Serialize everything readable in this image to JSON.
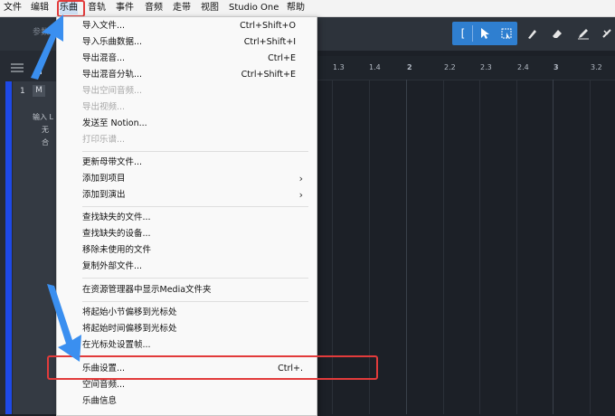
{
  "menubar": {
    "items": [
      "文件",
      "编辑",
      "乐曲",
      "音轨",
      "事件",
      "音频",
      "走带",
      "视图",
      "Studio One",
      "帮助"
    ]
  },
  "toolbar": {
    "param_label": "参数",
    "tools": [
      "select-arrow-icon",
      "range-select-icon",
      "paint-icon",
      "eraser-icon",
      "pencil-icon",
      "mute-icon"
    ]
  },
  "track": {
    "number": "1",
    "mute": "M",
    "input_label": "输入 L",
    "none": "无",
    "fit": "合"
  },
  "ruler": {
    "ticks": [
      "1.3",
      "1.4",
      "2",
      "2.2",
      "2.3",
      "2.4",
      "3",
      "3.2"
    ]
  },
  "song_menu": {
    "items": [
      {
        "label": "导入文件...",
        "shortcut": "Ctrl+Shift+O",
        "disabled": false,
        "submenu": false
      },
      {
        "label": "导入乐曲数据...",
        "shortcut": "Ctrl+Shift+I",
        "disabled": false,
        "submenu": false
      },
      {
        "label": "导出混音...",
        "shortcut": "Ctrl+E",
        "disabled": false,
        "submenu": false
      },
      {
        "label": "导出混音分轨...",
        "shortcut": "Ctrl+Shift+E",
        "disabled": false,
        "submenu": false
      },
      {
        "label": "导出空间音频...",
        "shortcut": "",
        "disabled": true,
        "submenu": false
      },
      {
        "label": "导出视频...",
        "shortcut": "",
        "disabled": true,
        "submenu": false
      },
      {
        "label": "发送至 Notion...",
        "shortcut": "",
        "disabled": false,
        "submenu": false
      },
      {
        "label": "打印乐谱...",
        "shortcut": "",
        "disabled": true,
        "submenu": false
      },
      {
        "label": "更新母带文件...",
        "shortcut": "",
        "disabled": false,
        "submenu": false
      },
      {
        "label": "添加到项目",
        "shortcut": "",
        "disabled": false,
        "submenu": true
      },
      {
        "label": "添加到演出",
        "shortcut": "",
        "disabled": false,
        "submenu": true
      },
      {
        "label": "查找缺失的文件...",
        "shortcut": "",
        "disabled": false,
        "submenu": false
      },
      {
        "label": "查找缺失的设备...",
        "shortcut": "",
        "disabled": false,
        "submenu": false
      },
      {
        "label": "移除未使用的文件",
        "shortcut": "",
        "disabled": false,
        "submenu": false
      },
      {
        "label": "复制外部文件...",
        "shortcut": "",
        "disabled": false,
        "submenu": false
      },
      {
        "label": "在资源管理器中显示Media文件夹",
        "shortcut": "",
        "disabled": false,
        "submenu": false
      },
      {
        "label": "将起始小节偏移到光标处",
        "shortcut": "",
        "disabled": false,
        "submenu": false
      },
      {
        "label": "将起始时间偏移到光标处",
        "shortcut": "",
        "disabled": false,
        "submenu": false
      },
      {
        "label": "在光标处设置帧...",
        "shortcut": "",
        "disabled": false,
        "submenu": false
      },
      {
        "label": "乐曲设置...",
        "shortcut": "Ctrl+.",
        "disabled": false,
        "submenu": false
      },
      {
        "label": "空间音频...",
        "shortcut": "",
        "disabled": false,
        "submenu": false
      },
      {
        "label": "乐曲信息",
        "shortcut": "",
        "disabled": false,
        "submenu": false
      }
    ]
  },
  "colors": {
    "highlight_box": "#e23b3b",
    "callout_arrow": "#3a8ff0",
    "tool_active": "#2f7fd0",
    "track_color": "#1e49e6"
  }
}
